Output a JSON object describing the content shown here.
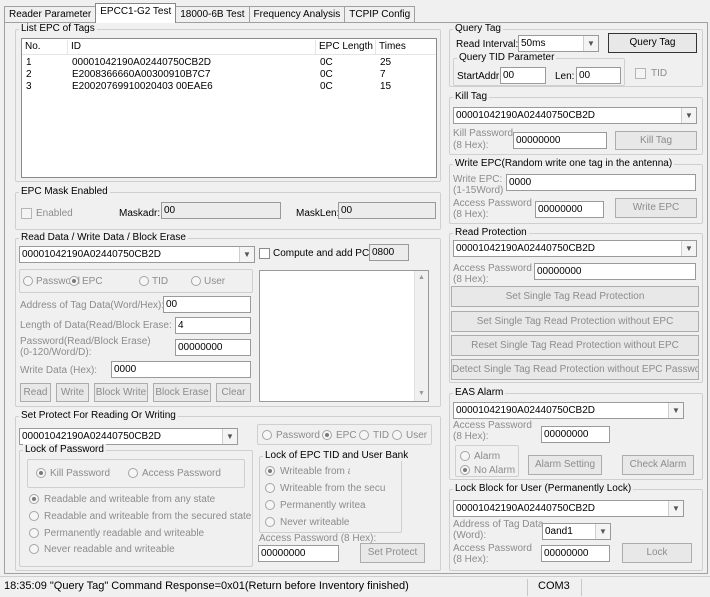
{
  "tabs": [
    "Reader Parameter",
    "EPCC1-G2 Test",
    "18000-6B Test",
    "Frequency Analysis",
    "TCPIP Config"
  ],
  "epc_list": {
    "title": "List EPC of Tags",
    "columns": [
      "No.",
      "ID",
      "EPC Length",
      "Times"
    ],
    "rows": [
      {
        "no": "1",
        "id": "00001042190A02440750CB2D",
        "len": "0C",
        "times": "25"
      },
      {
        "no": "2",
        "id": "E2008366660A00300910B7C7",
        "len": "0C",
        "times": "7"
      },
      {
        "no": "3",
        "id": "E20020769910020403 00EAE6",
        "len": "0C",
        "times": "15"
      }
    ]
  },
  "mask": {
    "title": "EPC Mask Enabled",
    "enabled": "Enabled",
    "maskadr_label": "Maskadr:",
    "maskadr": "00",
    "masklen_label": "MaskLen:",
    "masklen": "00"
  },
  "rw": {
    "title": "Read Data / Write Data / Block Erase",
    "tag": "00001042190A02440750CB2D",
    "compute_label": "Compute and add PC:",
    "pc": "0800",
    "mem": [
      "Password",
      "EPC",
      "TID",
      "User"
    ],
    "addr_label": "Address of Tag Data(Word/Hex):",
    "addr": "00",
    "len_label": "Length of Data(Read/Block Erase:",
    "len": "4",
    "pwd_label1": "Password(Read/Block Erase)",
    "pwd_label2": "(0-120/Word/D):",
    "pwd": "00000000",
    "write_label": "Write Data (Hex):",
    "write": "0000",
    "buttons": [
      "Read",
      "Write",
      "Block Write",
      "Block Erase",
      "Clear"
    ]
  },
  "protect": {
    "title": "Set Protect For Reading Or Writing",
    "tag": "00001042190A02440750CB2D",
    "lock_pwd_title": "Lock of Password",
    "kill_pwd": "Kill Password",
    "access_pwd": "Access Password",
    "options": [
      "Readable and writeable from any state",
      "Readable and writeable from the secured state",
      "Permanently readable and writeable",
      "Never readable and writeable"
    ],
    "mem": [
      "Password",
      "EPC",
      "TID",
      "User"
    ],
    "lock_epc_title": "Lock of EPC TID and User Bank",
    "epc_opts": [
      "Writeable from any state",
      "Writeable from the secure",
      "Permanently writeab",
      "Never writeable"
    ],
    "access_label": "Access Password (8 Hex):",
    "access": "00000000",
    "set_btn": "Set Protect"
  },
  "query": {
    "title": "Query Tag",
    "interval_label": "Read Interval:",
    "interval": "50ms",
    "btn": "Query Tag",
    "tid_title": "Query TID Parameter",
    "start_label": "StartAddr:",
    "start": "00",
    "len_label": "Len:",
    "len": "00",
    "tid_chk": "TID"
  },
  "kill": {
    "title": "Kill Tag",
    "tag": "00001042190A02440750CB2D",
    "pwd_label1": "Kill Password",
    "pwd_label2": "(8 Hex):",
    "pwd": "00000000",
    "btn": "Kill Tag"
  },
  "write_epc": {
    "title": "Write EPC(Random write one tag in the antenna)",
    "epc_label1": "Write EPC:",
    "epc_label2": "(1-15Word)",
    "epc": "0000",
    "pwd_label1": "Access Password",
    "pwd_label2": "(8 Hex):",
    "pwd": "00000000",
    "btn": "Write EPC"
  },
  "read_prot": {
    "title": "Read Protection",
    "tag": "00001042190A02440750CB2D",
    "pwd_label1": "Access Password",
    "pwd_label2": "(8 Hex):",
    "pwd": "00000000",
    "buttons": [
      "Set Single Tag Read Protection",
      "Set Single Tag Read Protection without EPC",
      "Reset Single Tag Read Protection without EPC",
      "Detect Single Tag Read Protection without EPC Password"
    ]
  },
  "eas": {
    "title": "EAS Alarm",
    "tag": "00001042190A02440750CB2D",
    "pwd_label1": "Access Password",
    "pwd_label2": "(8 Hex):",
    "pwd": "00000000",
    "alarm": "Alarm",
    "no_alarm": "No Alarm",
    "set_btn": "Alarm Setting",
    "check_btn": "Check Alarm"
  },
  "lock_block": {
    "title": "Lock Block for User (Permanently Lock)",
    "tag": "00001042190A02440750CB2D",
    "addr_label1": "Address of Tag Data",
    "addr_label2": "(Word):",
    "addr": "0and1",
    "pwd_label1": "Access Password",
    "pwd_label2": "(8 Hex):",
    "pwd": "00000000",
    "btn": "Lock"
  },
  "status": {
    "text": "18:35:09   \"Query Tag\"   Command Response=0x01(Return before Inventory finished)",
    "port": "COM3"
  }
}
